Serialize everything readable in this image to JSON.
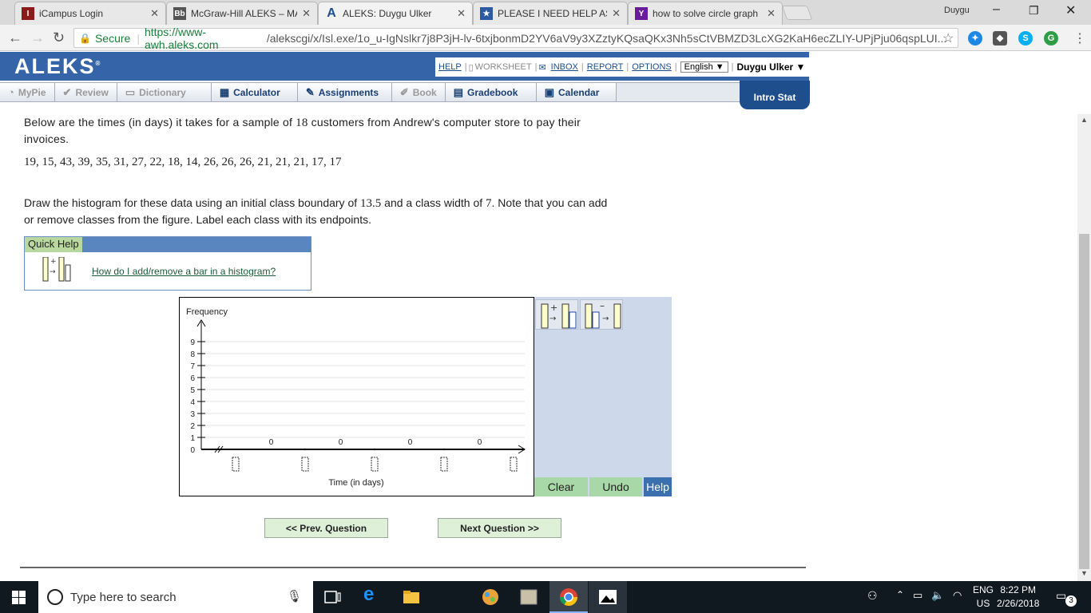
{
  "browser": {
    "tabs": [
      {
        "title": "iCampus Login",
        "fav_color": "#8b1a1a"
      },
      {
        "title": "McGraw-Hill ALEKS – MA",
        "fav_color": "#444"
      },
      {
        "title": "ALEKS: Duygu Ulker",
        "fav_color": "#1f4e8c"
      },
      {
        "title": "PLEASE I NEED HELP ASA",
        "fav_color": "#2c5aa0"
      },
      {
        "title": "how to solve circle graph",
        "fav_color": "#6a1b9a"
      }
    ],
    "window_user": "Duygu",
    "secure_label": "Secure",
    "url_host": "https://www-awh.aleks.com",
    "url_rest": "/alekscgi/x/Isl.exe/1o_u-IgNslkr7j8P3jH-lv-6txjbonmD2YV6aV9y3XZztyKQsaQKx3Nh5sCtVBMZD3LcXG2KaH6ecZLIY-UPjPju06qspLUI..."
  },
  "aleks": {
    "logo": "ALEKS",
    "links": {
      "help": "HELP",
      "worksheet": "WORKSHEET",
      "inbox": "INBOX",
      "report": "REPORT",
      "options": "OPTIONS"
    },
    "language": "English",
    "user": "Duygu Ulker",
    "tabs": [
      {
        "label": "MyPie",
        "icon": "◔",
        "enabled": false
      },
      {
        "label": "Review",
        "icon": "✔",
        "enabled": false
      },
      {
        "label": "Dictionary",
        "icon": "📖",
        "enabled": false
      },
      {
        "label": "Calculator",
        "icon": "▦",
        "enabled": true
      },
      {
        "label": "Assignments",
        "icon": "✎",
        "enabled": true
      },
      {
        "label": "Book",
        "icon": "✐",
        "enabled": false
      },
      {
        "label": "Gradebook",
        "icon": "▤",
        "enabled": true
      },
      {
        "label": "Calendar",
        "icon": "5",
        "enabled": true
      }
    ],
    "course": "Intro Stat"
  },
  "problem": {
    "intro_a": "Below are the times (in days) it takes for a sample of ",
    "sample_n": "18",
    "intro_b": " customers from Andrew's computer store to pay their invoices.",
    "data": "19, 15, 43, 39, 35, 31, 27, 22, 18, 14, 26, 26, 26, 21, 21, 21, 17, 17",
    "instr_a": "Draw the histogram for these data using an initial class boundary of ",
    "boundary": "13.5",
    "instr_b": " and a class width of ",
    "width": "7",
    "instr_c": ". Note that you can add or remove classes from the figure. Label each class with its endpoints."
  },
  "quick_help": {
    "title": "Quick Help",
    "link": "How do I add/remove a bar in a histogram?"
  },
  "chart_data": {
    "type": "bar",
    "ylabel": "Frequency",
    "xlabel": "Time (in days)",
    "ylim": [
      0,
      9
    ],
    "y_ticks": [
      "0",
      "1",
      "2",
      "3",
      "4",
      "5",
      "6",
      "7",
      "8",
      "9"
    ],
    "categories": [
      "",
      "",
      "",
      ""
    ],
    "values": [
      0,
      0,
      0,
      0
    ],
    "value_labels": [
      "0",
      "0",
      "0",
      "0"
    ]
  },
  "tools": {
    "clear": "Clear",
    "undo": "Undo",
    "help": "Help"
  },
  "nav": {
    "prev": "<< Prev. Question",
    "next": "Next Question >>"
  },
  "taskbar": {
    "search_placeholder": "Type here to search",
    "lang_line1": "ENG",
    "lang_line2": "US",
    "time": "8:22 PM",
    "date": "2/26/2018",
    "notif_count": "3"
  }
}
